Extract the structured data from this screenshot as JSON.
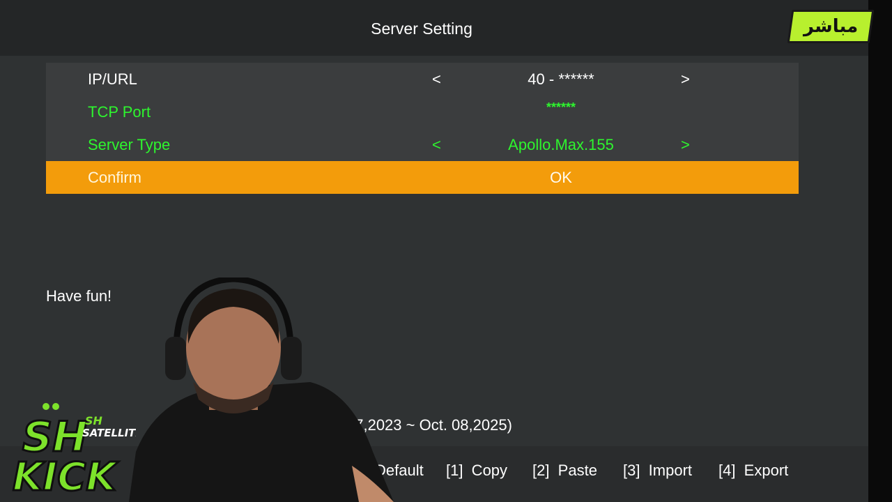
{
  "header": {
    "title": "Server Setting"
  },
  "live_badge": {
    "text": "مباشر",
    "color": "#b8f02e"
  },
  "settings": {
    "rows": [
      {
        "label": "IP/URL",
        "value": "40 - ******",
        "left_arrow": "<",
        "right_arrow": ">"
      },
      {
        "label": "TCP Port",
        "value": "******"
      },
      {
        "label": "Server Type",
        "value": "Apollo.Max.155",
        "left_arrow": "<",
        "right_arrow": ">"
      },
      {
        "label": "Confirm",
        "value": "OK"
      }
    ]
  },
  "hint": "Have fun!",
  "validity": "07,2023 ~ Oct. 08,2025)",
  "footer": {
    "keys": [
      {
        "label": "Default"
      },
      {
        "label": "[1]  Copy"
      },
      {
        "label": "[2]  Paste"
      },
      {
        "label": "[3]  Import"
      },
      {
        "label": "[4]  Export"
      }
    ]
  },
  "overlay_logo": {
    "line1": "SH",
    "line2": "SATELLITE",
    "line3": "KICK",
    "accent": "#7de22b"
  },
  "colors": {
    "highlight": "#f39c0b",
    "active_text": "#2ef52e",
    "panel": "#3b3d3e",
    "background": "#2f3233"
  }
}
